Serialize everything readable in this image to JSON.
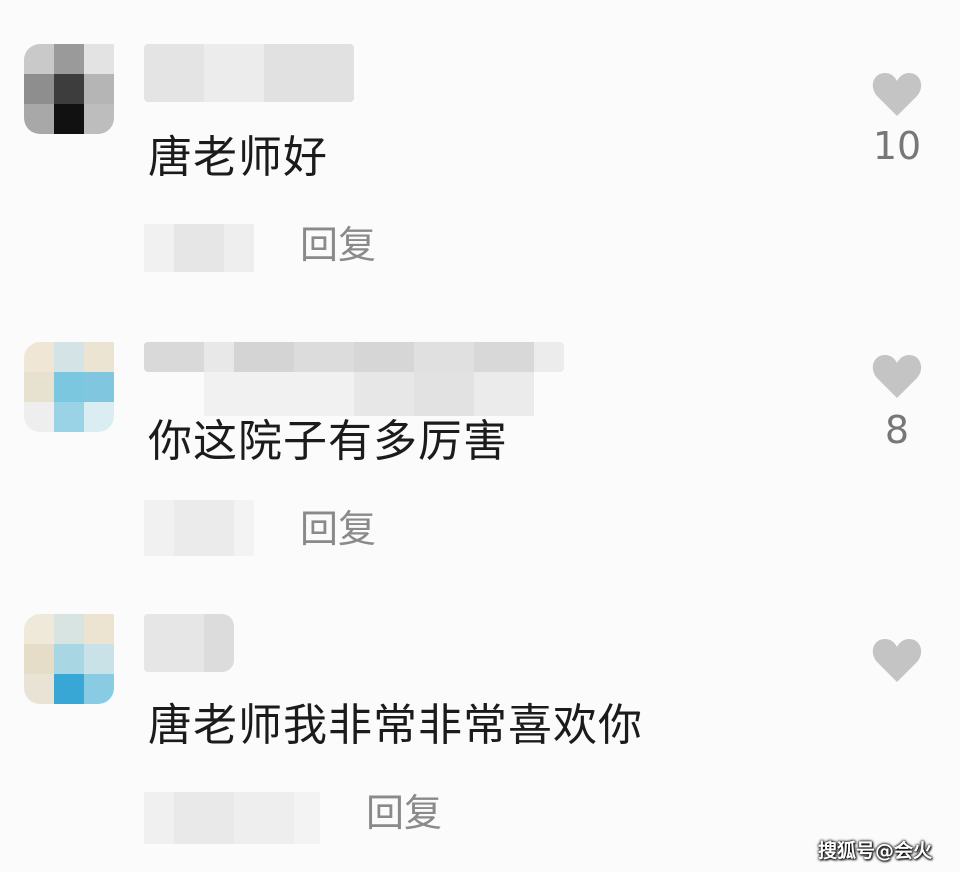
{
  "comments": [
    {
      "text": "唐老师好",
      "reply_label": "回复",
      "like_count": "10",
      "avatar_cells": [
        "#c9c9c9",
        "#9a9a9a",
        "#e3e3e3",
        "#8e8e8e",
        "#3d3d3d",
        "#b5b5b5",
        "#a8a8a8",
        "#111111",
        "#bdbdbd"
      ]
    },
    {
      "text": "你这院子有多厉害",
      "reply_label": "回复",
      "like_count": "8",
      "avatar_cells": [
        "#efe6d5",
        "#d3e3e6",
        "#ece4d2",
        "#e7e1cf",
        "#7bc7e0",
        "#7fc6de",
        "#eeeeee",
        "#99d3e5",
        "#d9edf3"
      ]
    },
    {
      "text": "唐老师我非常非常喜欢你",
      "reply_label": "回复",
      "like_count": "",
      "avatar_cells": [
        "#efe9da",
        "#d7e4e2",
        "#ece3d0",
        "#e6ddc9",
        "#a8d6e2",
        "#c9e2e8",
        "#e9e3d6",
        "#39a7d6",
        "#88cbe2"
      ]
    }
  ],
  "watermark": "搜狐号@会火",
  "icons": {
    "like": "heart-icon"
  },
  "colors": {
    "background": "#fbfbfb",
    "text": "#1b1b1b",
    "muted": "#8a8a8a",
    "heart": "#c4c4c4"
  }
}
